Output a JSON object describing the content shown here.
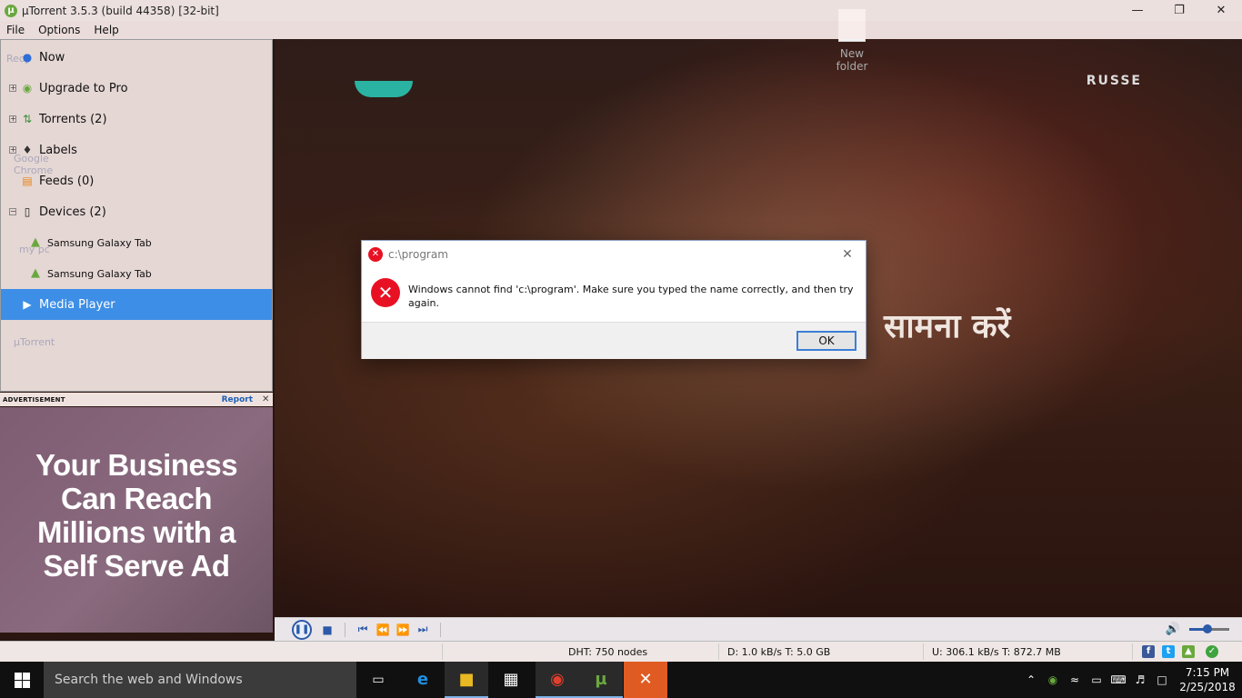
{
  "window": {
    "title": "µTorrent 3.5.3  (build 44358) [32-bit]",
    "controls": [
      "minimize",
      "maximize",
      "close"
    ]
  },
  "desktop": {
    "folder_label": "New folder",
    "ghost_labels": [
      "Recy",
      "Google Chrome",
      "my pc",
      "µTorrent"
    ]
  },
  "menu": {
    "items": [
      "File",
      "Options",
      "Help"
    ]
  },
  "sidebar": {
    "items": [
      {
        "label": "Now",
        "icon": "globe-icon",
        "expander": "none"
      },
      {
        "label": "Upgrade to Pro",
        "icon": "utorrent-icon",
        "expander": "plus"
      },
      {
        "label": "Torrents (2)",
        "icon": "updown-arrows-icon",
        "expander": "plus"
      },
      {
        "label": "Labels",
        "icon": "tag-icon",
        "expander": "plus"
      },
      {
        "label": "Feeds (0)",
        "icon": "rss-icon",
        "expander": "none"
      },
      {
        "label": "Devices (2)",
        "icon": "phone-icon",
        "expander": "minus"
      },
      {
        "label": "Samsung Galaxy Tab",
        "icon": "android-icon",
        "sub": true
      },
      {
        "label": "Samsung Galaxy Tab",
        "icon": "android-icon",
        "sub": true
      },
      {
        "label": "Media Player",
        "icon": "play-icon",
        "selected": true
      }
    ]
  },
  "ad": {
    "label": "ADVERTISEMENT",
    "report": "Report",
    "headline": "Your Business Can Reach Millions with a Self Serve Ad",
    "background": "#7e5c72"
  },
  "video": {
    "caption": "सामना करें",
    "corner_text": "RUSSE"
  },
  "player": {
    "volume_level": 0.45
  },
  "status": {
    "dht": "DHT: 750 nodes",
    "download": "D: 1.0 kB/s T: 5.0 GB",
    "upload": "U: 306.1 kB/s T: 872.7 MB"
  },
  "dialog": {
    "title": "c:\\program",
    "message": "Windows cannot find 'c:\\program'. Make sure you typed the name correctly, and then try again.",
    "ok": "OK",
    "accent": "#e81123"
  },
  "taskbar": {
    "search_placeholder": "Search the web and Windows",
    "time": "7:15 PM",
    "date": "2/25/2018"
  }
}
